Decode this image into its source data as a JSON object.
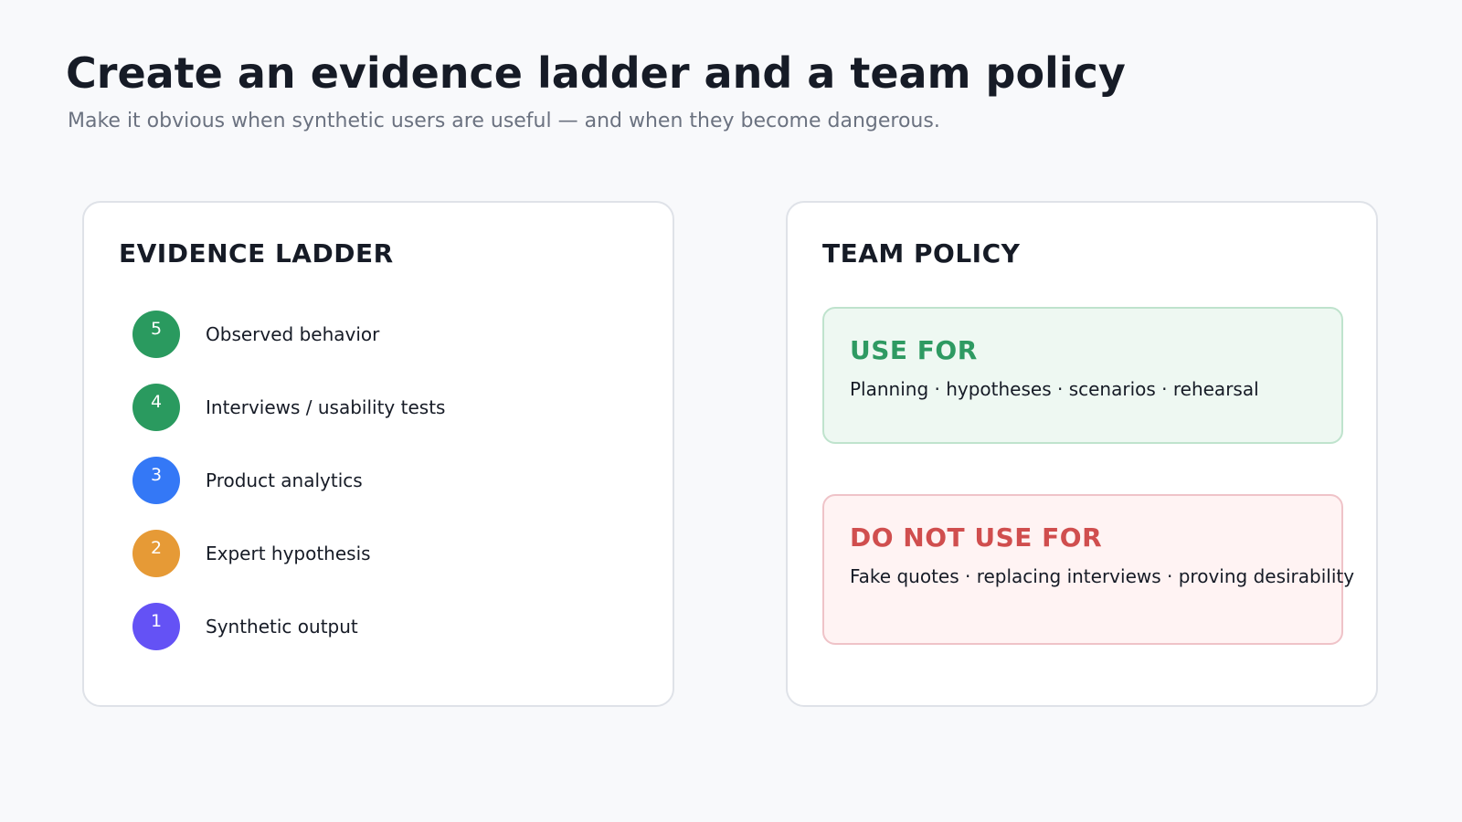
{
  "header": {
    "title": "Create an evidence ladder and a team policy",
    "subtitle": "Make it obvious when synthetic users are useful — and when they become dangerous."
  },
  "evidence_ladder": {
    "heading": "EVIDENCE LADDER",
    "steps": [
      {
        "number": "5",
        "label": "Observed behavior",
        "color": "#2a9a5f"
      },
      {
        "number": "4",
        "label": "Interviews / usability tests",
        "color": "#2a9a5f"
      },
      {
        "number": "3",
        "label": "Product analytics",
        "color": "#3478f6"
      },
      {
        "number": "2",
        "label": "Expert hypothesis",
        "color": "#e69a36"
      },
      {
        "number": "1",
        "label": "Synthetic output",
        "color": "#6452f5"
      }
    ]
  },
  "team_policy": {
    "heading": "TEAM POLICY",
    "use_for": {
      "title": "USE FOR",
      "text": "Planning · hypotheses · scenarios · rehearsal",
      "color": "#2e9a62"
    },
    "do_not_use_for": {
      "title": "DO NOT USE FOR",
      "text": "Fake quotes · replacing interviews · proving desirability",
      "color": "#d04e4e"
    }
  }
}
